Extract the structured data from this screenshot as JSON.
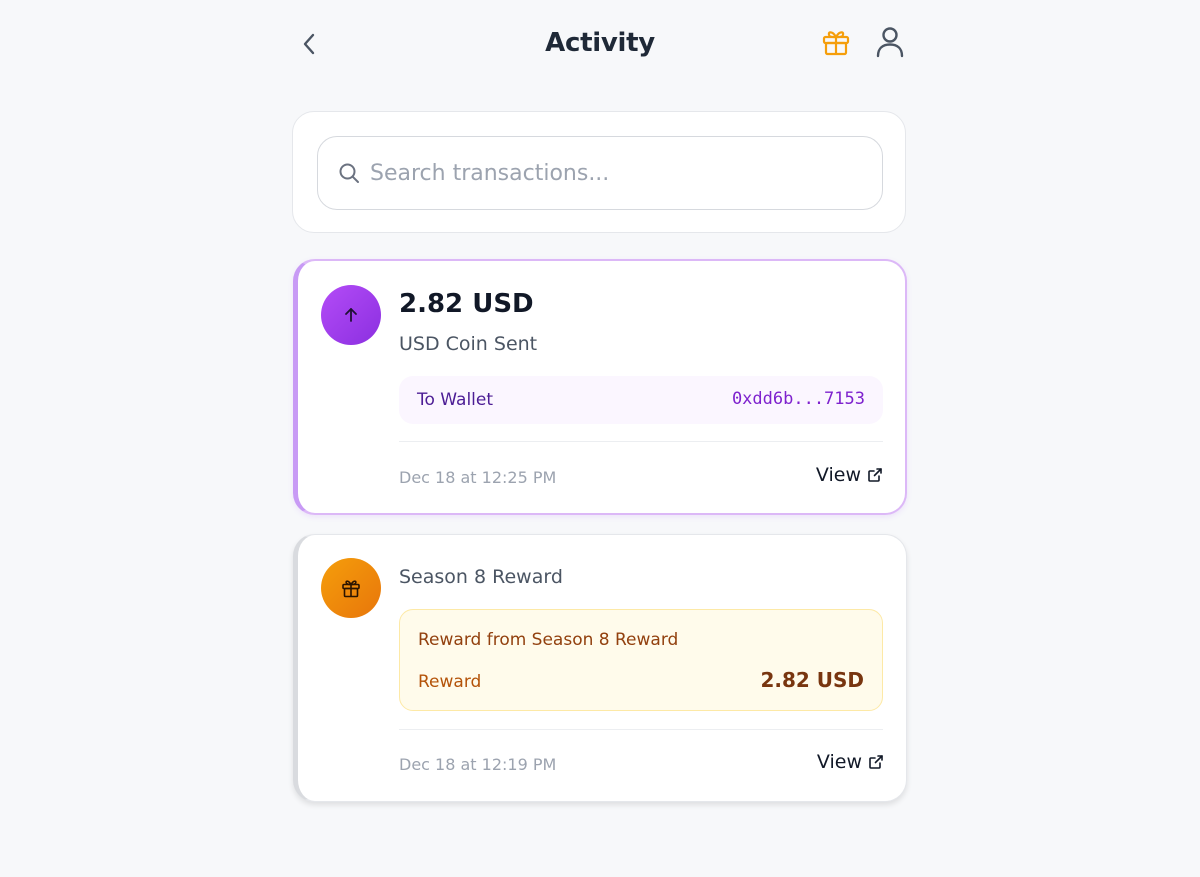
{
  "header": {
    "title": "Activity",
    "back_icon": "chevron-left-icon",
    "gift_icon": "gift-icon",
    "profile_icon": "user-icon"
  },
  "search": {
    "placeholder": "Search transactions...",
    "value": ""
  },
  "transactions": [
    {
      "type": "sent",
      "icon": "arrow-up-icon",
      "amount": "2.82 USD",
      "subtitle": "USD Coin Sent",
      "wallet_label": "To Wallet",
      "wallet_address": "0xdd6b...7153",
      "timestamp": "Dec 18 at 12:25 PM",
      "view_label": "View"
    },
    {
      "type": "reward",
      "icon": "gift-icon",
      "title": "Season 8 Reward",
      "reward_description": "Reward from Season 8 Reward",
      "reward_label": "Reward",
      "reward_value": "2.82 USD",
      "timestamp": "Dec 18 at 12:19 PM",
      "view_label": "View"
    }
  ],
  "colors": {
    "background": "#f7f8fa",
    "accent_purple": "#a855f7",
    "accent_orange": "#f59e0b",
    "gift_header": "#f59e0b"
  }
}
